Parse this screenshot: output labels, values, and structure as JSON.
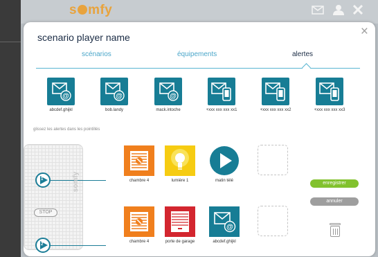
{
  "app": {
    "brand": "somfy"
  },
  "modal": {
    "title": "scenario player name",
    "close_glyph": "×"
  },
  "tabs": [
    {
      "label": "scénarios",
      "active": false
    },
    {
      "label": "équipements",
      "active": false
    },
    {
      "label": "alertes",
      "active": true
    }
  ],
  "contacts": [
    {
      "label": "abcdef.ghijkl",
      "icon": "email-alert-icon"
    },
    {
      "label": "bob.landy",
      "icon": "email-alert-icon"
    },
    {
      "label": "mack.intoche",
      "icon": "email-alert-icon"
    },
    {
      "label": "+xxx xxx xxx xx1",
      "icon": "sms-alert-icon"
    },
    {
      "label": "+xxx xxx xxx xx2",
      "icon": "sms-alert-icon"
    },
    {
      "label": "+xxx xxx xxx xx3",
      "icon": "sms-alert-icon"
    }
  ],
  "hint": "glissez les alertes dans les pointillés",
  "remote": {
    "button1": "1",
    "button2": "2",
    "stop_label": "STOP",
    "brand": "somfy"
  },
  "row1": [
    {
      "label": "chambre 4",
      "icon": "shutter-icon",
      "color": "#f07f1d"
    },
    {
      "label": "lumière 1",
      "icon": "light-bulb-icon",
      "color": "#f6cc12"
    },
    {
      "label": "matin télé",
      "icon": "play-scenario-icon",
      "color": "#177d95"
    }
  ],
  "row2": [
    {
      "label": "chambre 4",
      "icon": "shutter-icon",
      "color": "#f07f1d"
    },
    {
      "label": "porte de garage",
      "icon": "garage-door-icon",
      "color": "#d3262f"
    },
    {
      "label": "abcdef.ghijkl",
      "icon": "email-alert-icon",
      "color": "#177d95"
    }
  ],
  "actions": {
    "save_label": "enregistrer",
    "cancel_label": "annuler"
  },
  "colors": {
    "accent_blue": "#177d95",
    "save_green": "#82c22e",
    "cancel_grey": "#9e9e9e",
    "brand_orange": "#e8a33d"
  }
}
